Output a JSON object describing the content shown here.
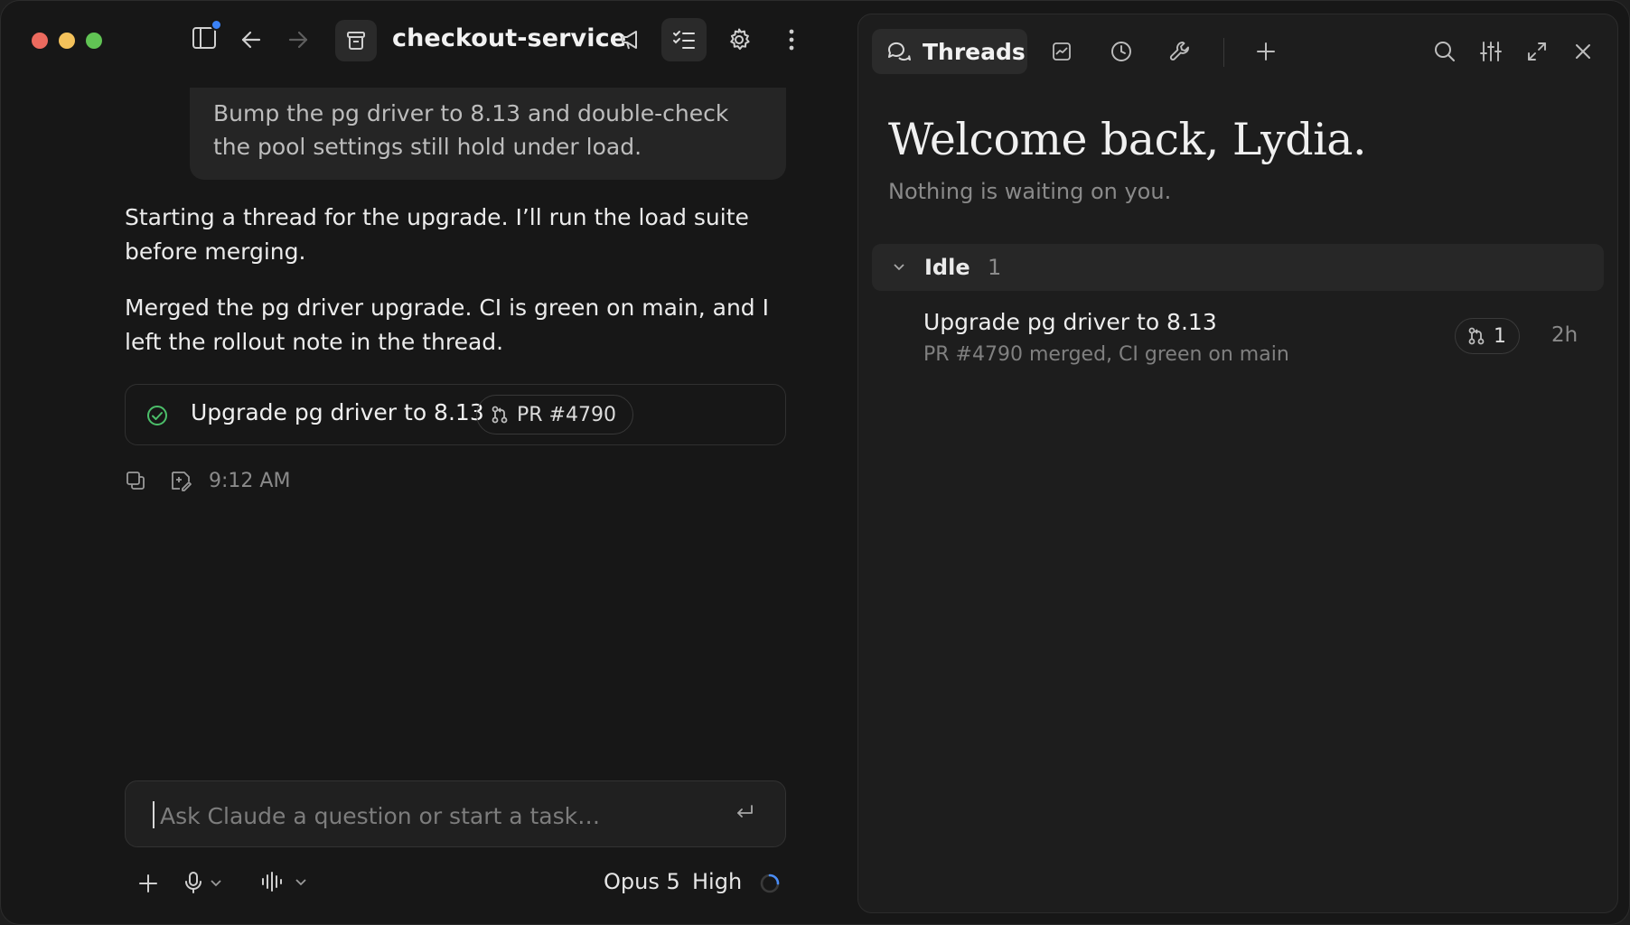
{
  "header": {
    "project_name": "checkout-service"
  },
  "conversation": {
    "user_message": "Bump the pg driver to 8.13 and double-check the pool settings still hold under load.",
    "assistant_paragraphs": [
      "Starting a thread for the upgrade. I’ll run the load suite before merging.",
      "Merged the pg driver upgrade. CI is green on main, and I left the rollout note in the thread."
    ],
    "task_card": {
      "title": "Upgrade pg driver to 8.13",
      "pr_label": "PR #4790",
      "status": "completed"
    },
    "timestamp": "9:12 AM"
  },
  "composer": {
    "placeholder": "Ask Claude a question or start a task…",
    "model": "Opus 5",
    "effort": "High"
  },
  "side_panel": {
    "active_tab": "Threads",
    "welcome": "Welcome back, Lydia.",
    "subtitle": "Nothing is waiting on you.",
    "groups": [
      {
        "name": "Idle",
        "count": "1",
        "threads": [
          {
            "title": "Upgrade pg driver to 8.13",
            "subtitle": "PR #4790 merged, CI green on main",
            "pr_count": "1",
            "age": "2h"
          }
        ]
      }
    ]
  },
  "colors": {
    "background": "#171717",
    "panel": "#1d1d1d",
    "success": "#4cbf6a",
    "accent_blue": "#3a82f7"
  },
  "icons": {
    "toolbar": [
      "sidebar-toggle-icon",
      "back-arrow-icon",
      "forward-arrow-icon",
      "archive-icon",
      "megaphone-icon",
      "checklist-icon",
      "gear-icon",
      "more-vertical-icon"
    ],
    "side_panel": [
      "threads-icon",
      "board-icon",
      "clock-icon",
      "wrench-icon",
      "plus-icon",
      "search-icon",
      "sliders-icon",
      "expand-icon",
      "close-icon"
    ]
  }
}
